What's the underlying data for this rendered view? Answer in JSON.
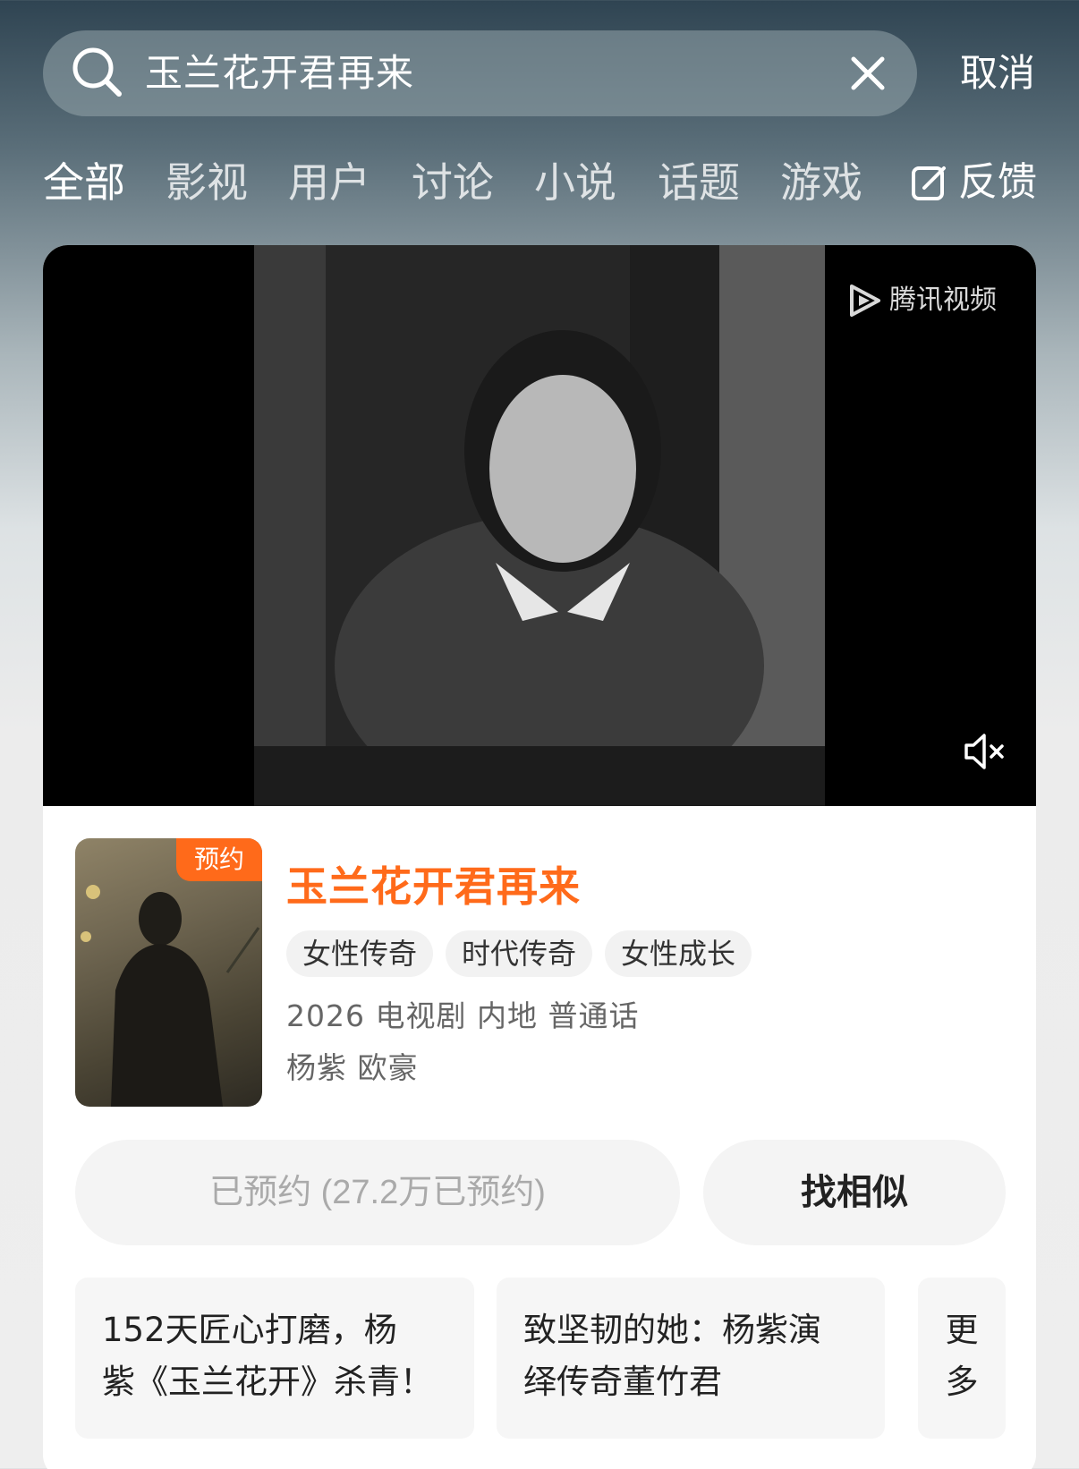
{
  "search": {
    "query": "玉兰花开君再来",
    "cancel_label": "取消"
  },
  "tabs": [
    "全部",
    "影视",
    "用户",
    "讨论",
    "小说",
    "话题",
    "游戏"
  ],
  "feedback_label": "反馈",
  "video": {
    "brand_text": "腾讯视频",
    "muted": true
  },
  "show": {
    "poster_badge": "预约",
    "title": "玉兰花开君再来",
    "tags": [
      "女性传奇",
      "时代传奇",
      "女性成长"
    ],
    "meta": "2026 电视剧 内地 普通话",
    "cast": "杨紫 欧豪"
  },
  "actions": {
    "reserved_label": "已预约 (27.2万已预约)",
    "similar_label": "找相似"
  },
  "news": [
    {
      "line1": "152天匠心打磨，杨",
      "line2": "紫《玉兰花开》杀青！"
    },
    {
      "line1": "致坚韧的她：杨紫演",
      "line2": "绎传奇董竹君"
    }
  ],
  "more": {
    "char1": "更",
    "char2": "多"
  },
  "colors": {
    "accent": "#ff6a1a"
  }
}
